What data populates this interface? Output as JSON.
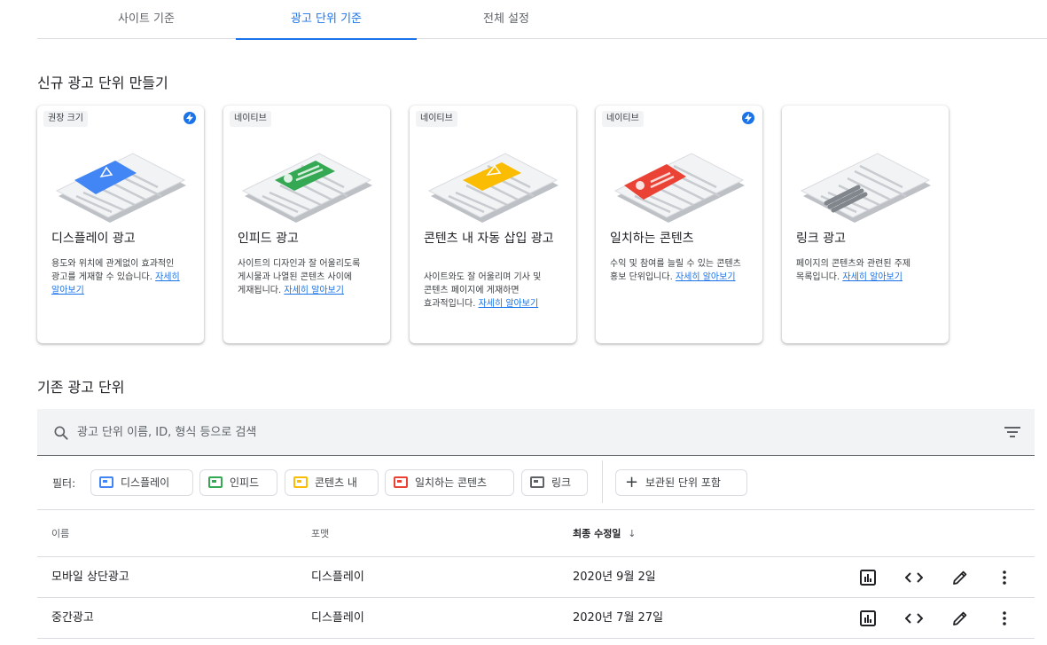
{
  "tabs": [
    {
      "label": "사이트 기준",
      "active": false
    },
    {
      "label": "광고 단위 기준",
      "active": true
    },
    {
      "label": "전체 설정",
      "active": false
    }
  ],
  "create_section": {
    "title": "신규 광고 단위 만들기"
  },
  "cards": [
    {
      "tag": "권장 크기",
      "bolt": true,
      "title": "디스플레이 광고",
      "desc": "용도와 위치에 관계없이 효과적인 광고를 게재할 수 있습니다.",
      "link": "자세히 알아보기",
      "accent": "#4285f4"
    },
    {
      "tag": "네이티브",
      "bolt": false,
      "title": "인피드 광고",
      "desc": "사이트의 디자인과 잘 어울리도록 게시물과 나열된 콘텐츠 사이에 게재됩니다.",
      "link": "자세히 알아보기",
      "accent": "#34a853"
    },
    {
      "tag": "네이티브",
      "bolt": false,
      "title": "콘텐츠 내 자동 삽입 광고",
      "desc": "사이트와도 잘 어울리며 기사 및 콘텐츠 페이지에 게재하면 효과적입니다.",
      "link": "자세히 알아보기",
      "accent": "#fbbc04"
    },
    {
      "tag": "네이티브",
      "bolt": true,
      "title": "일치하는 콘텐츠",
      "desc": "수익 및 참여를 늘릴 수 있는 콘텐츠 홍보 단위입니다.",
      "link": "자세히 알아보기",
      "accent": "#ea4335"
    },
    {
      "tag": "",
      "bolt": false,
      "title": "링크 광고",
      "desc": "페이지의 콘텐츠와 관련된 주제 목록입니다.",
      "link": "자세히 알아보기",
      "accent": "#80868b"
    }
  ],
  "existing_section": {
    "title": "기존 광고 단위"
  },
  "search": {
    "placeholder": "광고 단위 이름, ID, 형식 등으로 검색"
  },
  "filters": {
    "label": "필터:",
    "chips": [
      {
        "label": "디스플레이",
        "color": "#4285f4"
      },
      {
        "label": "인피드",
        "color": "#34a853"
      },
      {
        "label": "콘텐츠 내",
        "color": "#fbbc04"
      },
      {
        "label": "일치하는 콘텐츠",
        "color": "#ea4335"
      },
      {
        "label": "링크",
        "color": "#5f6368"
      }
    ],
    "archived": "보관된 단위 포함"
  },
  "table": {
    "headers": {
      "name": "이름",
      "format": "포맷",
      "modified": "최종 수정일",
      "sort_icon": "↓"
    },
    "rows": [
      {
        "name": "모바일 상단광고",
        "format": "디스플레이",
        "modified": "2020년 9월 2일"
      },
      {
        "name": "중간광고",
        "format": "디스플레이",
        "modified": "2020년 7월 27일"
      }
    ]
  }
}
